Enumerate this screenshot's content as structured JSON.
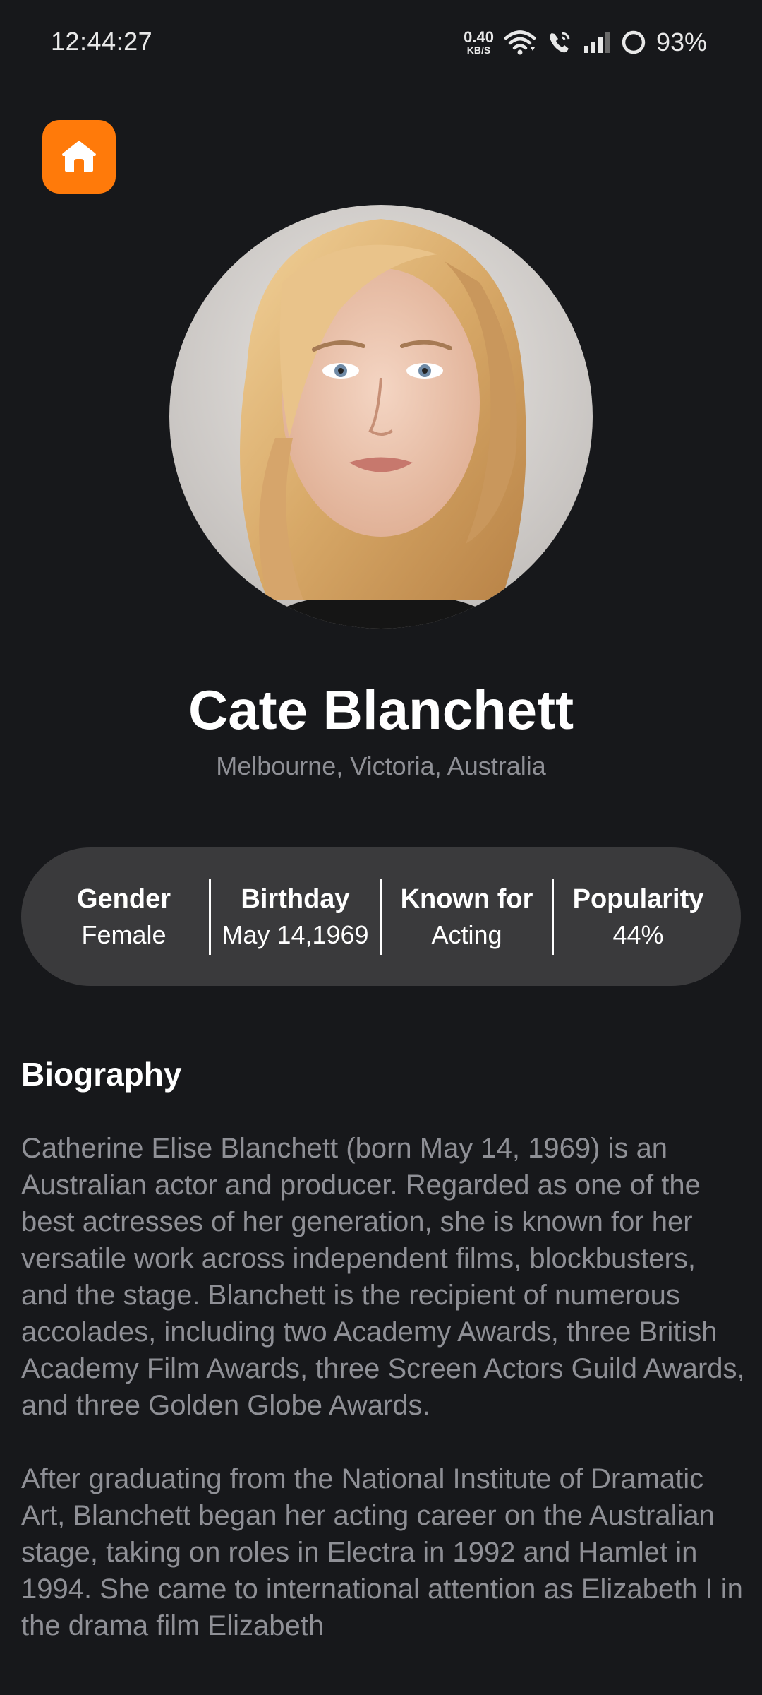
{
  "status_bar": {
    "time": "12:44:27",
    "net_speed_value": "0.40",
    "net_speed_unit": "KB/S",
    "battery": "93%"
  },
  "colors": {
    "background": "#17181b",
    "accent": "#ff7a0a",
    "pill": "#3a3a3c",
    "muted_text": "#8f9096"
  },
  "icons": {
    "home": "home-icon",
    "wifi": "wifi-icon",
    "wifi_call": "wifi-call-icon",
    "signal": "signal-icon",
    "battery": "battery-ring-icon"
  },
  "profile": {
    "name": "Cate Blanchett",
    "location": "Melbourne, Victoria, Australia"
  },
  "stats": [
    {
      "label": "Gender",
      "value": "Female"
    },
    {
      "label": "Birthday",
      "value": "May 14,1969"
    },
    {
      "label": "Known for",
      "value": "Acting"
    },
    {
      "label": "Popularity",
      "value": "44%"
    }
  ],
  "biography": {
    "heading": "Biography",
    "paragraphs": [
      "Catherine Elise Blanchett (born May 14, 1969) is an Australian actor and producer. Regarded as one of the best actresses of her generation, she is known for her versatile work across independent films, blockbusters, and the stage. Blanchett is the recipient of numerous accolades, including two Academy Awards, three British Academy Film Awards, three Screen Actors Guild Awards, and three Golden Globe Awards.",
      "After graduating from the National Institute of Dramatic Art, Blanchett began her acting career on the Australian stage, taking on roles in Electra in 1992 and Hamlet in 1994. She came to international attention as Elizabeth I in the drama film Elizabeth"
    ]
  }
}
